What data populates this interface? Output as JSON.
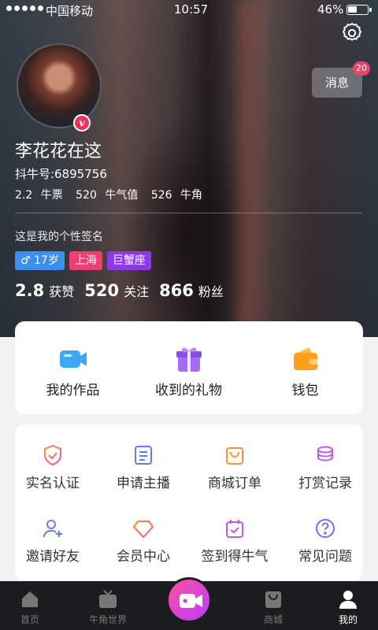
{
  "status_bar": {
    "carrier": "中国移动",
    "time": "10:57",
    "battery": "46%",
    "battery_level": 0.46
  },
  "header": {
    "message_button": "消息",
    "message_count": "20"
  },
  "profile": {
    "name": "李花花在这",
    "user_id": "抖牛号:6895756",
    "wallet_stats": [
      {
        "value": "2.2",
        "label": "牛票"
      },
      {
        "value": "520",
        "label": "牛气值"
      },
      {
        "value": "526",
        "label": "牛角"
      }
    ],
    "signature": "这是我的个性签名",
    "tags": [
      {
        "text": "♂ 17岁",
        "color": "#3b8ff3"
      },
      {
        "text": "上海",
        "color": "#ef3f72"
      },
      {
        "text": "巨蟹座",
        "color": "#8e39e8"
      }
    ],
    "social_stats": [
      {
        "value": "2.8",
        "label": "获赞"
      },
      {
        "value": "520",
        "label": "关注"
      },
      {
        "value": "866",
        "label": "粉丝"
      }
    ]
  },
  "main_menu": [
    {
      "label": "我的作品",
      "icon": "video-camera-icon"
    },
    {
      "label": "收到的礼物",
      "icon": "gift-icon"
    },
    {
      "label": "钱包",
      "icon": "wallet-icon"
    }
  ],
  "services": [
    {
      "label": "实名认证",
      "icon": "shield-check-icon"
    },
    {
      "label": "申请主播",
      "icon": "document-list-icon"
    },
    {
      "label": "商城订单",
      "icon": "shopping-bag-icon"
    },
    {
      "label": "打赏记录",
      "icon": "coin-stack-icon"
    },
    {
      "label": "邀请好友",
      "icon": "add-user-icon"
    },
    {
      "label": "会员中心",
      "icon": "diamond-icon"
    },
    {
      "label": "签到得牛气",
      "icon": "calendar-check-icon"
    },
    {
      "label": "常见问题",
      "icon": "question-icon"
    }
  ],
  "tabbar": [
    {
      "label": "首页",
      "icon": "home-icon"
    },
    {
      "label": "牛角世界",
      "icon": "tv-icon"
    },
    {
      "label": "",
      "icon": "live-camera-icon"
    },
    {
      "label": "商城",
      "icon": "bag-icon"
    },
    {
      "label": "我的",
      "icon": "profile-icon",
      "active": true
    }
  ]
}
